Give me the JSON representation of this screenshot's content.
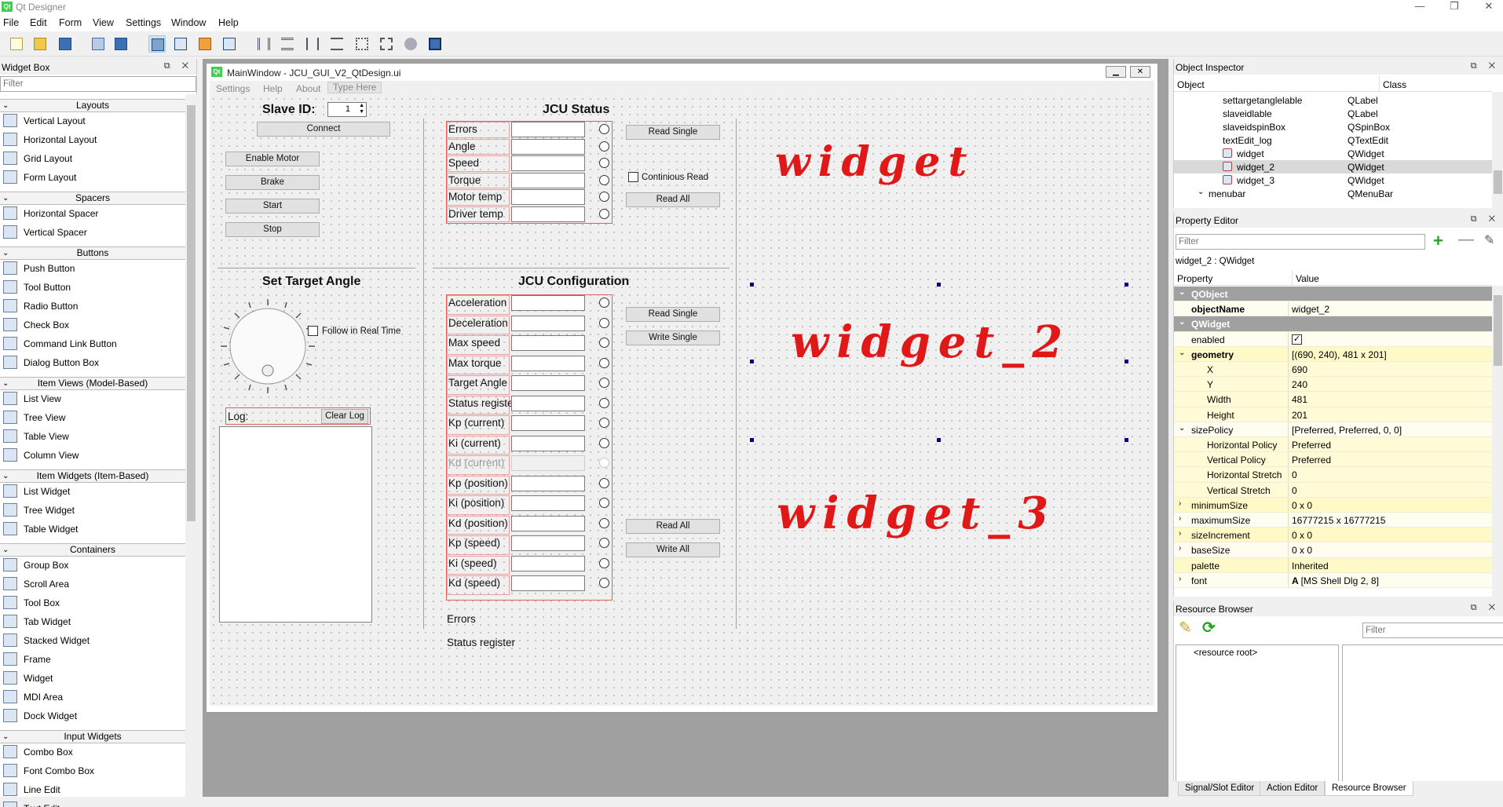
{
  "app": {
    "title": "Qt Designer"
  },
  "menubar": [
    "File",
    "Edit",
    "Form",
    "View",
    "Settings",
    "Window",
    "Help"
  ],
  "widget_box": {
    "title": "Widget Box",
    "filter_placeholder": "Filter",
    "categories": [
      {
        "label": "Layouts",
        "items": [
          "Vertical Layout",
          "Horizontal Layout",
          "Grid Layout",
          "Form Layout"
        ]
      },
      {
        "label": "Spacers",
        "items": [
          "Horizontal Spacer",
          "Vertical Spacer"
        ]
      },
      {
        "label": "Buttons",
        "items": [
          "Push Button",
          "Tool Button",
          "Radio Button",
          "Check Box",
          "Command Link Button",
          "Dialog Button Box"
        ]
      },
      {
        "label": "Item Views (Model-Based)",
        "items": [
          "List View",
          "Tree View",
          "Table View",
          "Column View"
        ]
      },
      {
        "label": "Item Widgets (Item-Based)",
        "items": [
          "List Widget",
          "Tree Widget",
          "Table Widget"
        ]
      },
      {
        "label": "Containers",
        "items": [
          "Group Box",
          "Scroll Area",
          "Tool Box",
          "Tab Widget",
          "Stacked Widget",
          "Frame",
          "Widget",
          "MDI Area",
          "Dock Widget"
        ]
      },
      {
        "label": "Input Widgets",
        "items": [
          "Combo Box",
          "Font Combo Box",
          "Line Edit",
          "Text Edit"
        ]
      }
    ]
  },
  "form_window": {
    "title": "MainWindow - JCU_GUI_V2_QtDesign.ui",
    "menu": [
      "Settings",
      "Help",
      "About",
      "Type Here"
    ],
    "slave_id_label": "Slave ID:",
    "slave_id_value": "1",
    "connect": "Connect",
    "enable_motor": "Enable Motor",
    "brake": "Brake",
    "start": "Start",
    "stop": "Stop",
    "set_target_angle": "Set Target Angle",
    "follow_real_time": "Follow in Real Time",
    "log_label": "Log:",
    "clear_log": "Clear Log",
    "status_title": "JCU Status",
    "status_rows": [
      "Errors",
      "Angle",
      "Speed",
      "Torque",
      "Motor temp",
      "Driver temp"
    ],
    "status_read_single": "Read Single",
    "continuous_read": "Continious Read",
    "status_read_all": "Read All",
    "config_title": "JCU Configuration",
    "config_rows": [
      "Acceleration",
      "Deceleration",
      "Max speed",
      "Max torque",
      "Target Angle",
      "Status register",
      "Kp (current)",
      "Ki (current)",
      "Kd (current)",
      "Kp (position)",
      "Ki (position)",
      "Kd (position)",
      "Kp (speed)",
      "Ki (speed)",
      "Kd (speed)"
    ],
    "config_read_single": "Read Single",
    "config_write_single": "Write Single",
    "config_read_all": "Read All",
    "config_write_all": "Write All",
    "bottom_errors": "Errors",
    "bottom_status_register": "Status register",
    "handwritten": [
      "widget",
      "widget_2",
      "widget_3"
    ]
  },
  "object_inspector": {
    "title": "Object Inspector",
    "col_object": "Object",
    "col_class": "Class",
    "rows": [
      {
        "name": "settargetanglelable",
        "cls": "QLabel"
      },
      {
        "name": "slaveidlable",
        "cls": "QLabel"
      },
      {
        "name": "slaveidspinBox",
        "cls": "QSpinBox"
      },
      {
        "name": "textEdit_log",
        "cls": "QTextEdit"
      },
      {
        "name": "widget",
        "cls": "QWidget"
      },
      {
        "name": "widget_2",
        "cls": "QWidget"
      },
      {
        "name": "widget_3",
        "cls": "QWidget"
      },
      {
        "name": "menubar",
        "cls": "QMenuBar"
      }
    ]
  },
  "property_editor": {
    "title": "Property Editor",
    "filter_placeholder": "Filter",
    "context": "widget_2 : QWidget",
    "col_property": "Property",
    "col_value": "Value",
    "rows": [
      {
        "n": "QObject",
        "v": "",
        "t": "grp"
      },
      {
        "n": "objectName",
        "v": "widget_2",
        "t": "bold"
      },
      {
        "n": "QWidget",
        "v": "",
        "t": "grp"
      },
      {
        "n": "enabled",
        "v": "",
        "t": "check"
      },
      {
        "n": "geometry",
        "v": "[(690, 240), 481 x 201]",
        "t": "boldexp"
      },
      {
        "n": "X",
        "v": "690",
        "t": "sub"
      },
      {
        "n": "Y",
        "v": "240",
        "t": "sub"
      },
      {
        "n": "Width",
        "v": "481",
        "t": "sub"
      },
      {
        "n": "Height",
        "v": "201",
        "t": "sub"
      },
      {
        "n": "sizePolicy",
        "v": "[Preferred, Preferred, 0, 0]",
        "t": "exp"
      },
      {
        "n": "Horizontal Policy",
        "v": "Preferred",
        "t": "sub"
      },
      {
        "n": "Vertical Policy",
        "v": "Preferred",
        "t": "sub"
      },
      {
        "n": "Horizontal Stretch",
        "v": "0",
        "t": "sub"
      },
      {
        "n": "Vertical Stretch",
        "v": "0",
        "t": "sub"
      },
      {
        "n": "minimumSize",
        "v": "0 x 0",
        "t": "col"
      },
      {
        "n": "maximumSize",
        "v": "16777215 x 16777215",
        "t": "col"
      },
      {
        "n": "sizeIncrement",
        "v": "0 x 0",
        "t": "col"
      },
      {
        "n": "baseSize",
        "v": "0 x 0",
        "t": "col"
      },
      {
        "n": "palette",
        "v": "Inherited",
        "t": "plain"
      },
      {
        "n": "font",
        "v": "[MS Shell Dlg 2, 8]",
        "t": "col"
      }
    ]
  },
  "resource_browser": {
    "title": "Resource Browser",
    "filter_placeholder": "Filter",
    "root": "<resource root>"
  },
  "bottom_tabs": [
    "Signal/Slot Editor",
    "Action Editor",
    "Resource Browser"
  ]
}
